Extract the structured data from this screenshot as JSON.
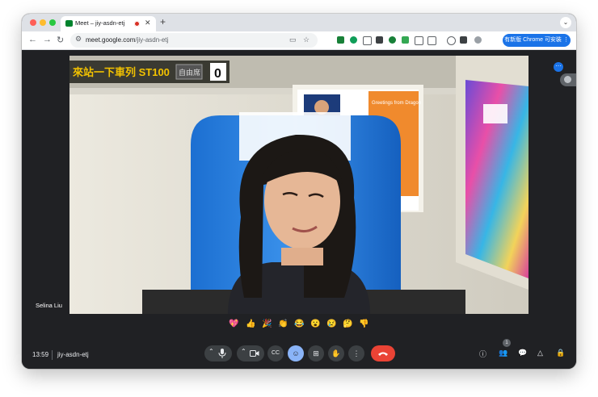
{
  "browser": {
    "tab_title": "Meet – jiy-asdn-etj",
    "url_host": "meet.google.com",
    "url_path": "/jiy-asdn-etj",
    "update_button": "有新版 Chrome 可安裝"
  },
  "meet": {
    "participant_name": "Selina Liu",
    "clock": "13:59",
    "meeting_code": "jiy-asdn-etj",
    "people_count": "1",
    "reactions": [
      "💖",
      "👍",
      "🎉",
      "👏",
      "😂",
      "😮",
      "😢",
      "🤔",
      "👎"
    ],
    "background_sign": {
      "text": "來站一下車列 ST100",
      "label": "自由席",
      "number": "0"
    },
    "poster_text": "Greetings from Dragon"
  },
  "colors": {
    "accent": "#1a73e8",
    "hangup": "#ea4335",
    "bar": "#202124"
  }
}
